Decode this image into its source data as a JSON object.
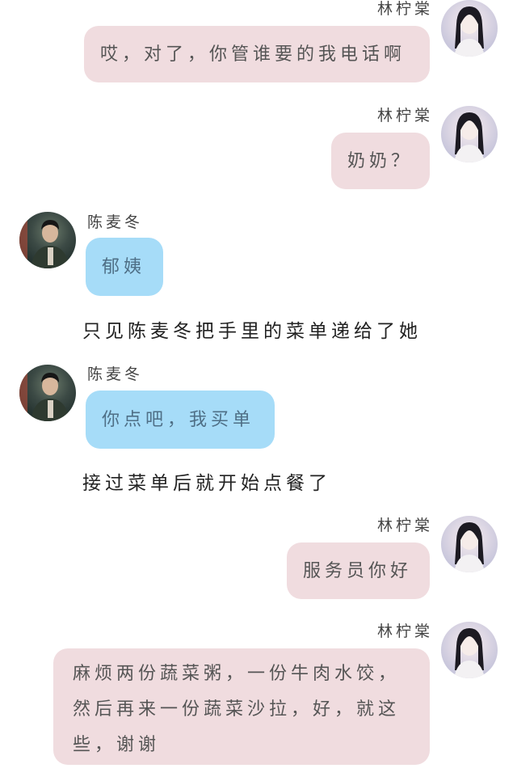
{
  "messages": [
    {
      "speaker": "林柠棠",
      "avatar": "girl-avatar",
      "text": "哎，对了，你管谁要的我电话啊"
    },
    {
      "speaker": "林柠棠",
      "avatar": "girl-avatar",
      "text": "奶奶？"
    },
    {
      "speaker": "陈麦冬",
      "avatar": "boy-avatar",
      "text": "郁姨"
    },
    {
      "narration": "只见陈麦冬把手里的菜单递给了她"
    },
    {
      "speaker": "陈麦冬",
      "avatar": "boy-avatar",
      "text": "你点吧，我买单"
    },
    {
      "narration": "接过菜单后就开始点餐了"
    },
    {
      "speaker": "林柠棠",
      "avatar": "girl-avatar",
      "text": "服务员你好"
    },
    {
      "speaker": "林柠棠",
      "avatar": "girl-avatar",
      "text": "麻烦两份蔬菜粥，一份牛肉水饺，然后再来一份蔬菜沙拉，好，就这些，谢谢"
    }
  ],
  "colors": {
    "female_bubble": "#f0dcdf",
    "male_bubble": "#a6dcf8",
    "background": "#ffffff"
  }
}
